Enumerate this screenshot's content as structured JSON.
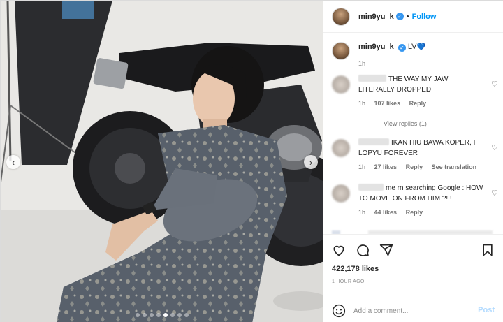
{
  "post": {
    "username": "min9yu_k",
    "follow_label": "Follow",
    "separator": "•",
    "more_label": "•••"
  },
  "caption": {
    "username": "min9yu_k",
    "text": "LV",
    "emoji": "💙",
    "time": "1h"
  },
  "comments": [
    {
      "text": "THE WAY MY JAW LITERALLY DROPPED.",
      "time": "1h",
      "likes": "107 likes",
      "reply": "Reply",
      "view_replies": "View replies (1)"
    },
    {
      "text": "IKAN HIU BAWA KOPER, I LOPYU FOREVER",
      "time": "1h",
      "likes": "27 likes",
      "reply": "Reply",
      "see_translation": "See translation"
    },
    {
      "text": "me rn searching Google : HOW TO MOVE ON FROM HIM ?!!!",
      "time": "1h",
      "likes": "44 likes",
      "reply": "Reply"
    }
  ],
  "icons": [
    "heart-icon",
    "comment-icon",
    "share-icon",
    "bookmark-icon",
    "emoji-icon",
    "verified-icon",
    "chevron-left-icon",
    "chevron-right-icon"
  ],
  "stats": {
    "likes": "422,178 likes",
    "posted": "1 HOUR AGO"
  },
  "composer": {
    "placeholder": "Add a comment...",
    "post_label": "Post"
  },
  "carousel": {
    "slides": 8,
    "active_index": 4
  },
  "colors": {
    "accent": "#0095f6",
    "verified": "#3797f0",
    "post_disabled": "#b3dbff"
  }
}
